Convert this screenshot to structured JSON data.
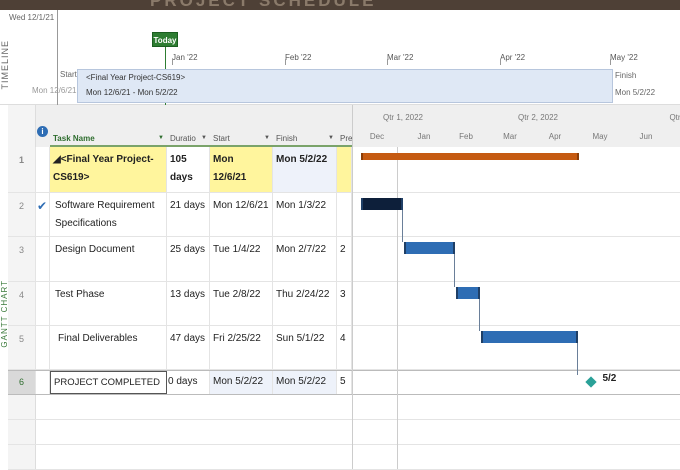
{
  "banner": {
    "title": "PROJECT SCHEDULE"
  },
  "side_labels": {
    "timeline": "TIMELINE",
    "gantt": "GANTT CHART"
  },
  "timeline": {
    "current_date": "Wed 12/1/21",
    "today_label": "Today",
    "months": [
      "Jan '22",
      "Feb '22",
      "Mar '22",
      "Apr '22",
      "May '22"
    ],
    "start_label": "Start",
    "start_date": "Mon 12/6/21",
    "finish_label": "Finish",
    "finish_date": "Mon 5/2/22",
    "project_name": "<Final Year Project-CS619>",
    "project_range": "Mon 12/6/21 - Mon 5/2/22"
  },
  "columns": {
    "info": "i",
    "task_name": "Task Name",
    "duration": "Duratio",
    "start": "Start",
    "finish": "Finish",
    "pred": "Pre"
  },
  "timescale": {
    "quarters": [
      "Qtr 1, 2022",
      "Qtr 2, 2022",
      "Qtr"
    ],
    "months": [
      "Dec",
      "Jan",
      "Feb",
      "Mar",
      "Apr",
      "May",
      "Jun"
    ]
  },
  "tasks": [
    {
      "id": "1",
      "indicator": "",
      "name": "◢<Final Year Project-CS619>",
      "duration": "105 days",
      "start": "Mon 12/6/21",
      "finish": "Mon 5/2/22",
      "pred": "",
      "type": "summary"
    },
    {
      "id": "2",
      "indicator": "✔",
      "name": "Software Requirement Specifications",
      "duration": "21 days",
      "start": "Mon 12/6/21",
      "finish": "Mon 1/3/22",
      "pred": "",
      "type": "done"
    },
    {
      "id": "3",
      "indicator": "",
      "name": "Design Document",
      "duration": "25 days",
      "start": "Tue 1/4/22",
      "finish": "Mon 2/7/22",
      "pred": "2",
      "type": "task"
    },
    {
      "id": "4",
      "indicator": "",
      "name": "Test Phase",
      "duration": "13 days",
      "start": "Tue 2/8/22",
      "finish": "Thu 2/24/22",
      "pred": "3",
      "type": "task"
    },
    {
      "id": "5",
      "indicator": "",
      "name": "Final Deliverables",
      "duration": "47 days",
      "start": "Fri 2/25/22",
      "finish": "Sun 5/1/22",
      "pred": "4",
      "type": "task"
    },
    {
      "id": "6",
      "indicator": "",
      "name": "PROJECT COMPLETED",
      "duration": "0 days",
      "start": "Mon 5/2/22",
      "finish": "Mon 5/2/22",
      "pred": "5",
      "type": "milestone"
    }
  ],
  "milestone_label": "5/2",
  "colors": {
    "summary": "#c55a11",
    "task": "#2e6db4",
    "done": "#0d1f3a",
    "milestone": "#2aa198",
    "highlight": "#fff59d"
  }
}
